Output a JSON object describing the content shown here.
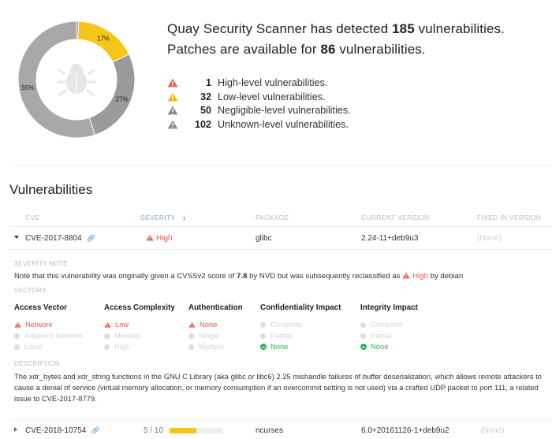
{
  "chart_data": {
    "type": "pie",
    "style": "donut",
    "slices": [
      {
        "label": "High",
        "value": 1,
        "color": "#e85e48",
        "display": ""
      },
      {
        "label": "Low",
        "value": 32,
        "color": "#f5c518",
        "display": "17%"
      },
      {
        "label": "Negligible",
        "value": 50,
        "color": "#9a9a9a",
        "display": "27%"
      },
      {
        "label": "Unknown",
        "value": 102,
        "color": "#a8a8a8",
        "display": "55%"
      }
    ],
    "center_icon": "bug-icon"
  },
  "summary": {
    "line1_prefix": "Quay Security Scanner has detected ",
    "line1_count": "185",
    "line1_suffix": " vulnerabilities.",
    "line2_prefix": "Patches are available for ",
    "line2_count": "86",
    "line2_suffix": " vulnerabilities.",
    "counts": [
      {
        "num": "1",
        "label": "High-level vulnerabilities.",
        "color": "#e85e48"
      },
      {
        "num": "32",
        "label": "Low-level vulnerabilities.",
        "color": "#f0b800"
      },
      {
        "num": "50",
        "label": "Negligible-level vulnerabilities.",
        "color": "#888888"
      },
      {
        "num": "102",
        "label": "Unknown-level vulnerabilities.",
        "color": "#888888"
      }
    ]
  },
  "vulnerabilities": {
    "title": "Vulnerabilities",
    "columns": {
      "cve": "CVE",
      "severity": "SEVERITY",
      "sort_icon": "↓",
      "package": "PACKAGE",
      "current_version": "CURRENT VERSION",
      "fixed_in_version": "FIXED IN VERSION"
    },
    "rows": [
      {
        "cve": "CVE-2017-8804",
        "severity": "High",
        "package": "glibc",
        "current_version": "2.24-11+deb9u3",
        "fixed_in_version": "(None)"
      },
      {
        "cve": "CVE-2018-10754",
        "severity_score": "5 / 10",
        "severity_fraction": 0.5,
        "package": "ncurses",
        "current_version": "6.0+20161126-1+deb9u2",
        "fixed_in_version": "(None)"
      }
    ]
  },
  "details": {
    "severity_note_label": "SEVERITY NOTE",
    "note_prefix": "Note that this vulnerability was originally given a CVSSv2 score of ",
    "note_score": "7.8",
    "note_middle": " by NVD but was subsequently reclassified as ",
    "note_severity": "High",
    "note_suffix": " by debian",
    "vectors_label": "VECTORS",
    "vectors": [
      {
        "title": "Access Vector",
        "items": [
          "Network",
          "Adjacent Network",
          "Local"
        ]
      },
      {
        "title": "Access Complexity",
        "items": [
          "Low",
          "Medium",
          "High"
        ]
      },
      {
        "title": "Authentication",
        "items": [
          "None",
          "Single",
          "Multiple"
        ]
      },
      {
        "title": "Confidentiality Impact",
        "items": [
          "Complete",
          "Partial",
          "None"
        ]
      },
      {
        "title": "Integrity Impact",
        "items": [
          "Complete",
          "Partial",
          "None"
        ]
      }
    ],
    "description_label": "DESCRIPTION",
    "description": "The xdr_bytes and xdr_string functions in the GNU C Library (aka glibc or libc6) 2.25 mishandle failures of buffer deserialization, which allows remote attackers to cause a denial of service (virtual memory allocation, or memory consumption if an overcommit setting is not used) via a crafted UDP packet to port 111, a related issue to CVE-2017-8779."
  }
}
